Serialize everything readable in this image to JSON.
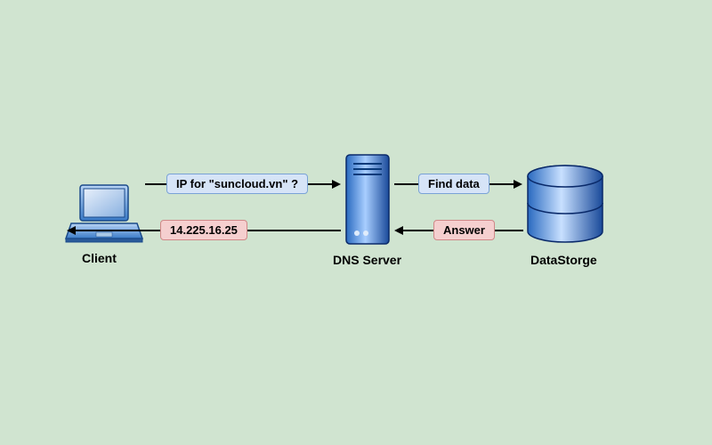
{
  "nodes": {
    "client": "Client",
    "dns_server": "DNS Server",
    "data_storage": "DataStorge"
  },
  "flows": {
    "query": "IP for \"suncloud.vn\" ?",
    "find": "Find data",
    "answer": "Answer",
    "ip": "14.225.16.25"
  }
}
